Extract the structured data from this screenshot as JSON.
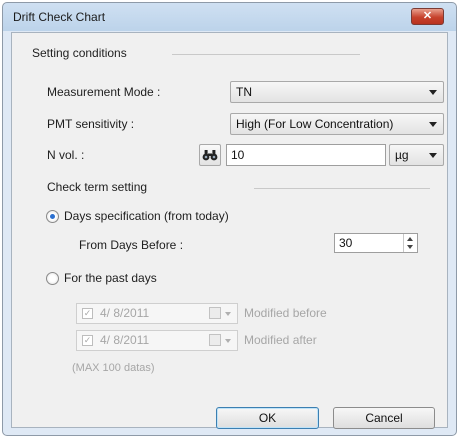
{
  "window": {
    "title": "Drift Check Chart",
    "close_glyph": "✕"
  },
  "setting_conditions": {
    "heading": "Setting conditions",
    "measurement_mode": {
      "label": "Measurement Mode :",
      "value": "TN"
    },
    "pmt_sensitivity": {
      "label": "PMT sensitivity :",
      "value": "High (For Low Concentration)"
    },
    "n_vol": {
      "label": "N vol. :",
      "value": "10",
      "unit": "µg",
      "search_icon": "binoculars-icon"
    }
  },
  "check_term": {
    "heading": "Check term setting",
    "days_spec": {
      "label": "Days specification (from today)",
      "selected": true
    },
    "from_days_before": {
      "label": "From Days Before :",
      "value": "30"
    },
    "past_days": {
      "label": "For the past days",
      "selected": false
    },
    "modified_before": {
      "date": "4/  8/2011",
      "label": "Modified before"
    },
    "modified_after": {
      "date": "4/  8/2011",
      "label": "Modified after"
    },
    "max_note": "(MAX 100 datas)"
  },
  "buttons": {
    "ok": "OK",
    "cancel": "Cancel"
  },
  "colors": {
    "titlebar": "#bcd3ea",
    "close": "#c7422d",
    "radio_selected": "#2a6fd0"
  }
}
